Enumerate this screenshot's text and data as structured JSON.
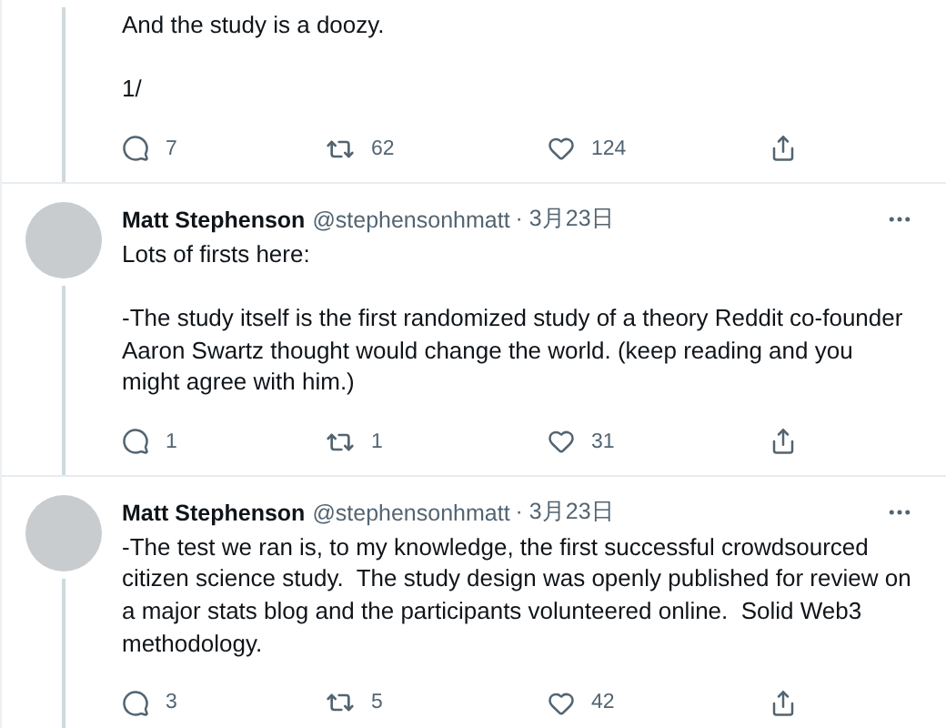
{
  "tweets": [
    {
      "text": "And the study is a doozy.\n\n1/",
      "actions": {
        "replies": "7",
        "retweets": "62",
        "likes": "124"
      }
    },
    {
      "author": {
        "name": "Matt Stephenson",
        "handle": "@stephensonhmatt",
        "date": "· 3月23日"
      },
      "text": "Lots of firsts here:\n\n-The study itself is the first randomized study of a theory Reddit co-founder Aaron Swartz thought would change the world. (keep reading and you might agree with him.)",
      "actions": {
        "replies": "1",
        "retweets": "1",
        "likes": "31"
      }
    },
    {
      "author": {
        "name": "Matt Stephenson",
        "handle": "@stephensonhmatt",
        "date": "· 3月23日"
      },
      "text": "-The test we ran is, to my knowledge, the first successful crowdsourced citizen science study.  The study design was openly published for review on a major stats blog and the participants volunteered online.  Solid Web3 methodology.",
      "actions": {
        "replies": "3",
        "retweets": "5",
        "likes": "42"
      }
    }
  ]
}
